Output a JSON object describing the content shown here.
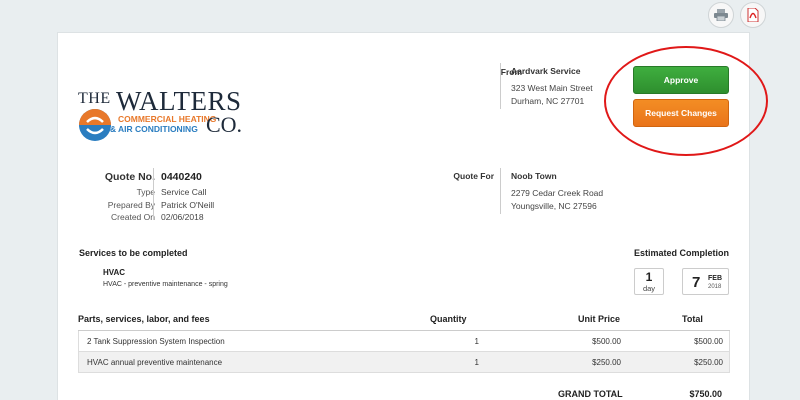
{
  "toolbar": {
    "print_icon": "printer-icon",
    "pdf_icon": "pdf-icon"
  },
  "logo": {
    "the": "THE",
    "walters": "WALTERS",
    "line1": "COMMERCIAL HEATING",
    "amp": "&",
    "line2": "AIR CONDITIONING",
    "co": "CO."
  },
  "from": {
    "label": "From",
    "name": "Aardvark Service",
    "address1": "323 West Main Street",
    "address2": "Durham, NC 27701"
  },
  "actions": {
    "approve": "Approve",
    "request_changes": "Request Changes",
    "approve_color": "#3a9f3a",
    "changes_color": "#ef7f1f",
    "highlight_color": "#e01818"
  },
  "quote": {
    "no_label": "Quote No.",
    "no_value": "0440240",
    "type_label": "Type",
    "type_value": "Service Call",
    "prepared_label": "Prepared By",
    "prepared_value": "Patrick O'Neill",
    "created_label": "Created On",
    "created_value": "02/06/2018"
  },
  "quote_for": {
    "label": "Quote For",
    "name": "Noob Town",
    "address1": "2279 Cedar Creek Road",
    "address2": "Youngsville, NC 27596"
  },
  "services": {
    "title": "Services to be completed",
    "name": "HVAC",
    "description": "HVAC - preventive maintenance - spring"
  },
  "estimate": {
    "title": "Estimated Completion",
    "days": "1",
    "days_unit": "day",
    "date_day": "7",
    "date_month": "FEB",
    "date_year": "2018"
  },
  "table": {
    "headers": {
      "name": "Parts, services, labor, and fees",
      "qty": "Quantity",
      "price": "Unit Price",
      "total": "Total"
    },
    "rows": [
      {
        "name": "2 Tank Suppression System Inspection",
        "qty": "1",
        "price": "$500.00",
        "total": "$500.00"
      },
      {
        "name": "HVAC annual preventive maintenance",
        "qty": "1",
        "price": "$250.00",
        "total": "$250.00"
      }
    ],
    "grand_label": "GRAND TOTAL",
    "grand_value": "$750.00"
  }
}
